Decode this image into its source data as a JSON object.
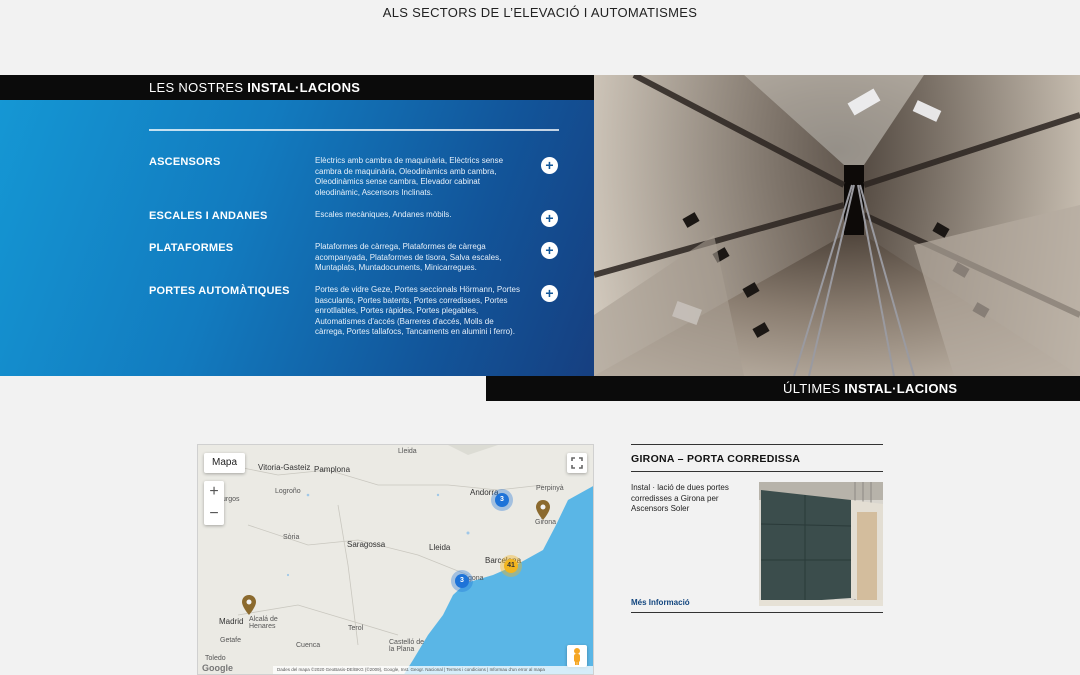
{
  "tagline": "ALS SECTORS DE L’ELEVACIÓ I AUTOMATISMES",
  "installations": {
    "heading_prefix": "LES NOSTRES ",
    "heading_bold": "INSTAL·LACIONS",
    "categories": [
      {
        "title": "ASCENSORS",
        "description": "Elèctrics amb cambra de maquinària, Elèctrics sense cambra de maquinària, Oleodinàmics amb cambra, Oleodinàmics sense cambra, Elevador cabinat oleodinàmic, Ascensors Inclinats.",
        "action": "+"
      },
      {
        "title": "ESCALES I ANDANES",
        "description": "Escales mecàniques, Andanes mòbils.",
        "action": "+"
      },
      {
        "title": "PLATAFORMES",
        "description": "Plataformes de càrrega, Plataformes de càrrega acompanyada, Plataformes de tisora, Salva escales, Muntaplats, Muntadocuments, Minicarregues.",
        "action": "+"
      },
      {
        "title": "PORTES AUTOMÀTIQUES",
        "description": "Portes de vidre Geze, Portes seccionals Hörmann, Portes basculants, Portes batents, Portes corredisses, Portes enrotllables, Portes ràpides, Portes plegables, Automatismes d'accés (Barreres d'accés, Molls de càrrega, Portes tallafocs, Tancaments en alumini i ferro).",
        "action": "+"
      }
    ]
  },
  "latest": {
    "heading_prefix": "ÚLTIMES ",
    "heading_bold": "INSTAL·LACIONS"
  },
  "map": {
    "type_button": "Mapa",
    "zoom_in": "+",
    "zoom_out": "−",
    "labels": {
      "vitoria": "Vitoria-Gasteiz",
      "pamplona": "Pamplona",
      "lleida_top": "Lleida",
      "burgos": "urgos",
      "logrono": "Logroño",
      "andorra": "Andorra",
      "perpinya": "Perpinyà",
      "girona": "Girona",
      "saragossa": "Saragossa",
      "soria": "Sòria",
      "lleida": "Lleida",
      "barcelona": "Barcelona",
      "tarragona": "gona",
      "madrid": "Madrid",
      "alcala": "Alcalá de Henares",
      "getafe": "Getafe",
      "terol": "Terol",
      "castello": "Castelló de la Plana",
      "toledo": "Toledo",
      "cuenca": "Cuenca"
    },
    "clusters": [
      "3",
      "41",
      "3"
    ],
    "footer": "Dades del mapa ©2020 GeoBasis-DE/BKG (©2009), Google, Inst. Geogr. Nacional | Termes i condicions | Informau d'un error al mapa",
    "logo": "Google"
  },
  "card": {
    "title": "GIRONA – PORTA CORREDISSA",
    "text": "Instal · lació de dues portes corredisses a Girona per Ascensors Soler",
    "link": "Més Informació"
  }
}
